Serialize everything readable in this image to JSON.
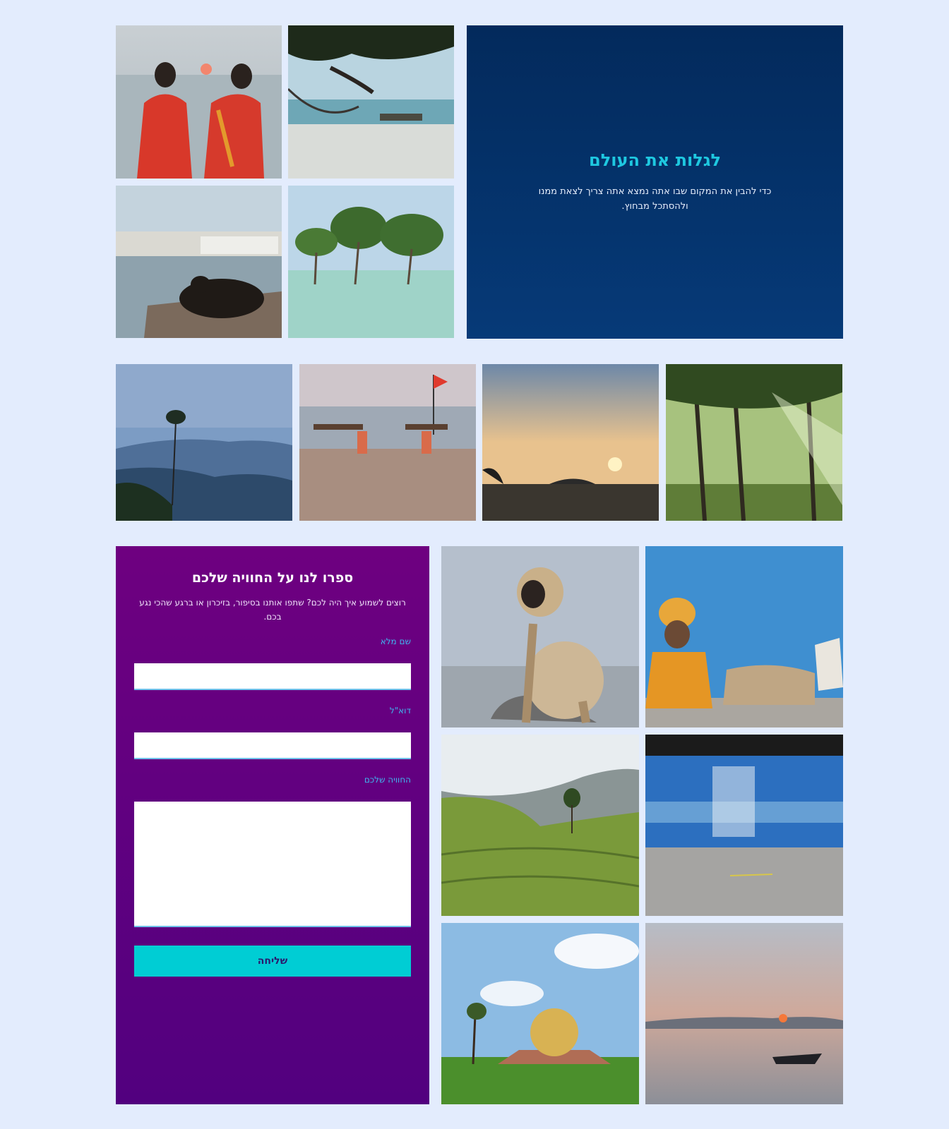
{
  "hero": {
    "title": "לגלות את העולם",
    "text": "כדי להבין את המקום שבו אתה נמצא אתה צריך לצאת ממנו ולהסתכל מבחוץ."
  },
  "form": {
    "title": "ספרו לנו על החוויה שלכם",
    "intro": "רוצים לשמוע איך היה לכם? שתפו אותנו בסיפור, בזיכרון או ברגע שהכי נגע בכם.",
    "name_label": "שם מלא",
    "email_label": "דוא\"ל",
    "experience_label": "החוויה שלכם",
    "submit_label": "שליחה"
  },
  "colors": {
    "page_background": "#e3ecfd",
    "hero_background": "#052f68",
    "hero_title": "#1ec8e0",
    "form_background": "#5f0080",
    "form_label": "#3fb6f0",
    "button": "#00cdd4"
  },
  "gallery": {
    "top": [
      "women-at-sunset-photo",
      "hammock-on-beach-photo",
      "cow-by-lake-town-photo",
      "mangroves-in-water-photo"
    ],
    "middle": [
      "misty-mountain-photo",
      "beach-carriers-flag-photo",
      "sunset-over-mudflats-photo",
      "palm-forest-light-photo"
    ],
    "bottom": [
      "langur-monkey-photo",
      "sadhu-blue-wall-photo",
      "tea-plantation-photo",
      "blurred-blue-train-photo",
      "golden-dome-photo",
      "boat-at-sunset-photo"
    ]
  }
}
